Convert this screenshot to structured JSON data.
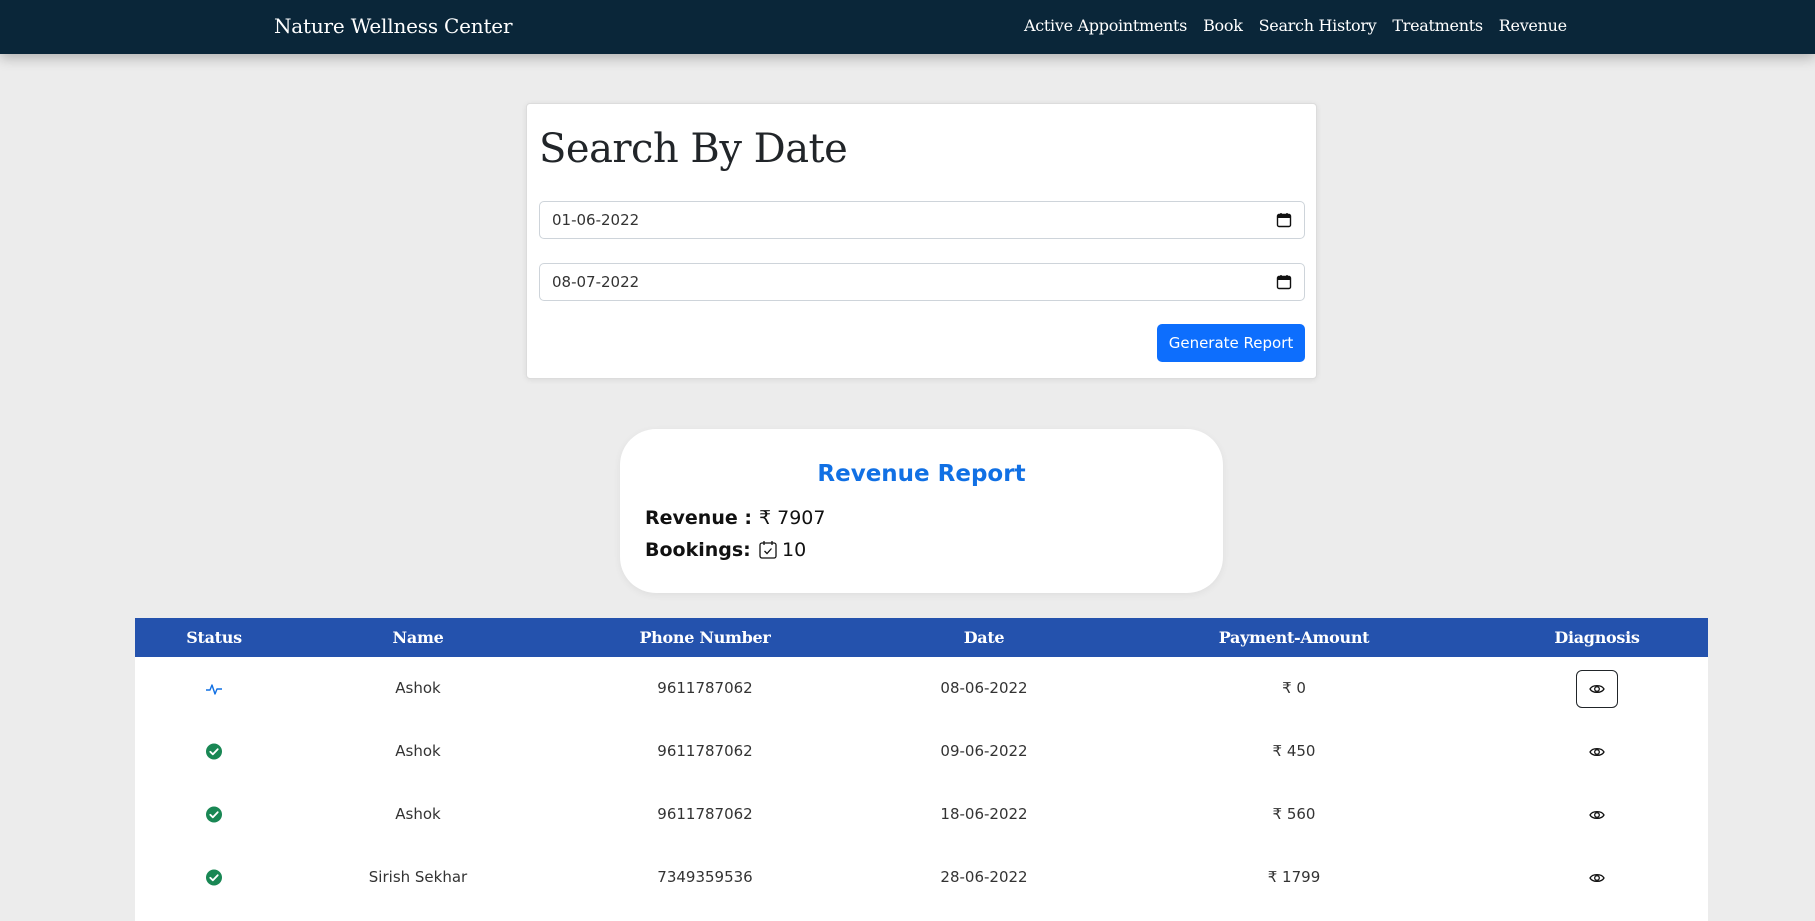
{
  "navbar": {
    "brand": "Nature Wellness Center",
    "links": [
      "Active Appointments",
      "Book",
      "Search History",
      "Treatments",
      "Revenue"
    ]
  },
  "search": {
    "title": "Search By Date",
    "from_date": "01-06-2022",
    "to_date": "08-07-2022",
    "button_label": "Generate Report",
    "calendar_icon": "calendar-icon"
  },
  "report": {
    "title": "Revenue Report",
    "revenue_label": "Revenue :",
    "revenue_value": "₹ 7907",
    "bookings_label": "Bookings:",
    "bookings_value": "10",
    "bookings_icon": "calendar-check-icon"
  },
  "table": {
    "headers": [
      "Status",
      "Name",
      "Phone Number",
      "Date",
      "Payment-Amount",
      "Diagnosis"
    ],
    "rows": [
      {
        "status": "activity-icon",
        "name": "Ashok",
        "phone": "9611787062",
        "date": "08-06-2022",
        "amount": "₹ 0",
        "diagnosis": "eye-icon"
      },
      {
        "status": "check-circle-icon",
        "name": "Ashok",
        "phone": "9611787062",
        "date": "09-06-2022",
        "amount": "₹ 450",
        "diagnosis": "eye-icon"
      },
      {
        "status": "check-circle-icon",
        "name": "Ashok",
        "phone": "9611787062",
        "date": "18-06-2022",
        "amount": "₹ 560",
        "diagnosis": "eye-icon"
      },
      {
        "status": "check-circle-icon",
        "name": "Sirish Sekhar",
        "phone": "7349359536",
        "date": "28-06-2022",
        "amount": "₹ 1799",
        "diagnosis": "eye-icon"
      }
    ]
  },
  "colors": {
    "navbar_bg": "#0a2639",
    "accent": "#0d6efd",
    "table_header": "#2452ad",
    "report_title": "#1170e4",
    "success": "#198754"
  }
}
